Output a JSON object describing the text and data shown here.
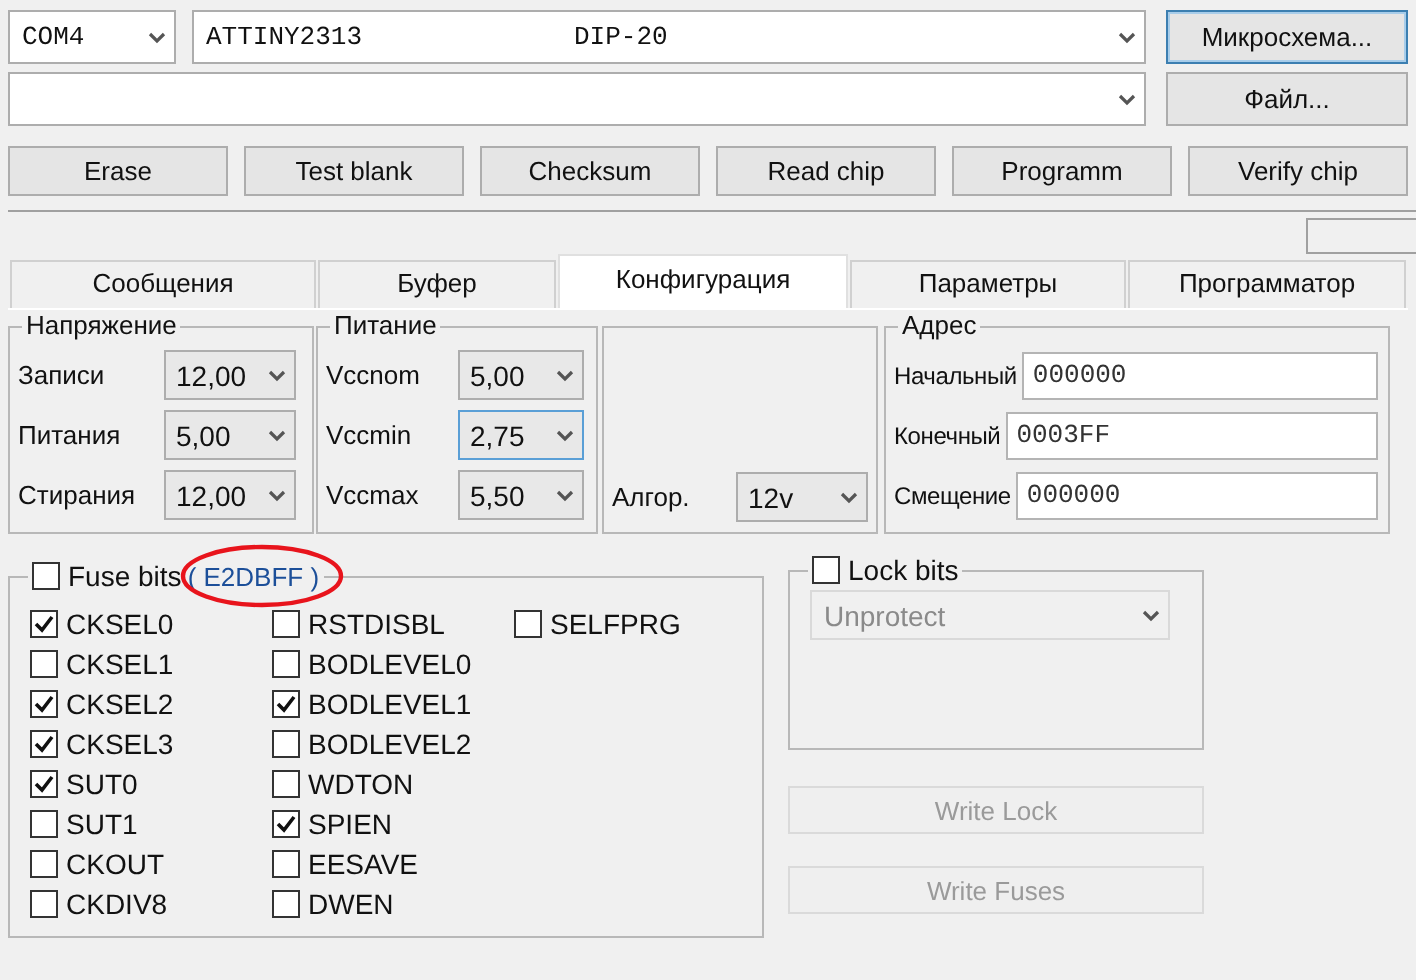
{
  "port_select": {
    "value": "COM4"
  },
  "chip_select": {
    "name": "ATTINY2313",
    "package": "DIP-20"
  },
  "chip_button": {
    "label": "Микросхема...",
    "focused": true
  },
  "file_button": {
    "label": "Файл...",
    "focused": false
  },
  "action_buttons": [
    "Erase",
    "Test blank",
    "Checksum",
    "Read chip",
    "Programm",
    "Verify chip"
  ],
  "tabs": [
    {
      "label": "Сообщения",
      "selected": false
    },
    {
      "label": "Буфер",
      "selected": false
    },
    {
      "label": "Конфигурация",
      "selected": true
    },
    {
      "label": "Параметры",
      "selected": false
    },
    {
      "label": "Программатор",
      "selected": false
    }
  ],
  "voltage": {
    "title": "Напряжение",
    "rows": [
      {
        "label": "Записи",
        "value": "12,00",
        "focused": false
      },
      {
        "label": "Питания",
        "value": "5,00",
        "focused": false
      },
      {
        "label": "Стирания",
        "value": "12,00",
        "focused": false
      }
    ]
  },
  "power": {
    "title": "Питание",
    "rows": [
      {
        "label": "Vccnom",
        "value": "5,00",
        "focused": false
      },
      {
        "label": "Vccmin",
        "value": "2,75",
        "focused": true
      },
      {
        "label": "Vccmax",
        "value": "5,50",
        "focused": false
      }
    ]
  },
  "algorithm": {
    "label": "Алгор.",
    "value": "12v"
  },
  "address": {
    "title": "Адрес",
    "rows": [
      {
        "label": "Начальный",
        "value": "000000"
      },
      {
        "label": "Конечный",
        "value": "0003FF"
      },
      {
        "label": "Смещение",
        "value": "000000"
      }
    ]
  },
  "fuse_bits": {
    "label": "Fuse bits",
    "checked": false,
    "value": "( E2DBFF )",
    "columns": [
      [
        {
          "label": "CKSEL0",
          "checked": true
        },
        {
          "label": "CKSEL1",
          "checked": false
        },
        {
          "label": "CKSEL2",
          "checked": true
        },
        {
          "label": "CKSEL3",
          "checked": true
        },
        {
          "label": "SUT0",
          "checked": true
        },
        {
          "label": "SUT1",
          "checked": false
        },
        {
          "label": "CKOUT",
          "checked": false
        },
        {
          "label": "CKDIV8",
          "checked": false
        }
      ],
      [
        {
          "label": "RSTDISBL",
          "checked": false
        },
        {
          "label": "BODLEVEL0",
          "checked": false
        },
        {
          "label": "BODLEVEL1",
          "checked": true
        },
        {
          "label": "BODLEVEL2",
          "checked": false
        },
        {
          "label": "WDTON",
          "checked": false
        },
        {
          "label": "SPIEN",
          "checked": true
        },
        {
          "label": "EESAVE",
          "checked": false
        },
        {
          "label": "DWEN",
          "checked": false
        }
      ],
      [
        {
          "label": "SELFPRG",
          "checked": false
        }
      ]
    ]
  },
  "lock_bits": {
    "label": "Lock bits",
    "checked": false,
    "mode": "Unprotect",
    "disabled": true
  },
  "write_buttons": [
    {
      "label": "Write Lock",
      "disabled": true
    },
    {
      "label": "Write Fuses",
      "disabled": true
    }
  ]
}
